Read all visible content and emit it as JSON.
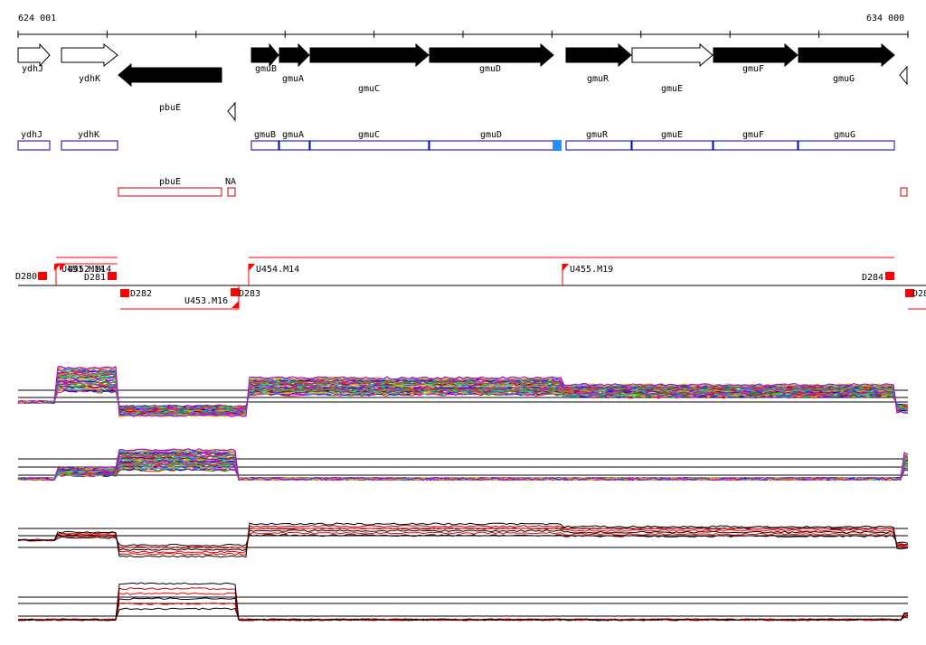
{
  "coords": {
    "start": "624 001",
    "end": "634 000"
  },
  "colors": {
    "gene_fill": "#000000",
    "gene_open_fill": "#ffffff",
    "cds_box": "#0000cc",
    "cds_marker": "#1e90ff",
    "rna_box": "#cc0000",
    "segment": "#ff0000",
    "profile_line": "#ff0000",
    "profile_black": "#000000"
  },
  "genes": [
    {
      "name": "ydhJ",
      "strand": "+",
      "filled": false
    },
    {
      "name": "ydhK",
      "strand": "+",
      "filled": false
    },
    {
      "name": "pbuE",
      "strand": "-",
      "filled": true
    },
    {
      "name": "gmuB",
      "strand": "+",
      "filled": true
    },
    {
      "name": "gmuA",
      "strand": "+",
      "filled": true
    },
    {
      "name": "gmuC",
      "strand": "+",
      "filled": true
    },
    {
      "name": "gmuD",
      "strand": "+",
      "filled": true
    },
    {
      "name": "gmuR",
      "strand": "+",
      "filled": true
    },
    {
      "name": "gmuE",
      "strand": "+",
      "filled": false
    },
    {
      "name": "gmuF",
      "strand": "+",
      "filled": true
    },
    {
      "name": "gmuG",
      "strand": "+",
      "filled": true
    }
  ],
  "cds_boxes": [
    "ydhJ",
    "ydhK",
    "gmuB",
    "gmuA",
    "gmuC",
    "gmuD",
    "gmuR",
    "gmuE",
    "gmuF",
    "gmuG"
  ],
  "rna_boxes": [
    "pbuE",
    "NA"
  ],
  "segments": {
    "downstream": [
      "D280",
      "D281",
      "D282",
      "D283",
      "D284",
      "D28"
    ],
    "upstream": [
      "U451.M14",
      "U452.M14",
      "U453.M16",
      "U454.M14",
      "U455.M19"
    ]
  },
  "tracks": [
    {
      "name": "expression-track-1",
      "style": "multicolor"
    },
    {
      "name": "expression-track-2",
      "style": "multicolor"
    },
    {
      "name": "expression-track-3",
      "style": "red-black"
    },
    {
      "name": "expression-track-4",
      "style": "red-black"
    }
  ]
}
